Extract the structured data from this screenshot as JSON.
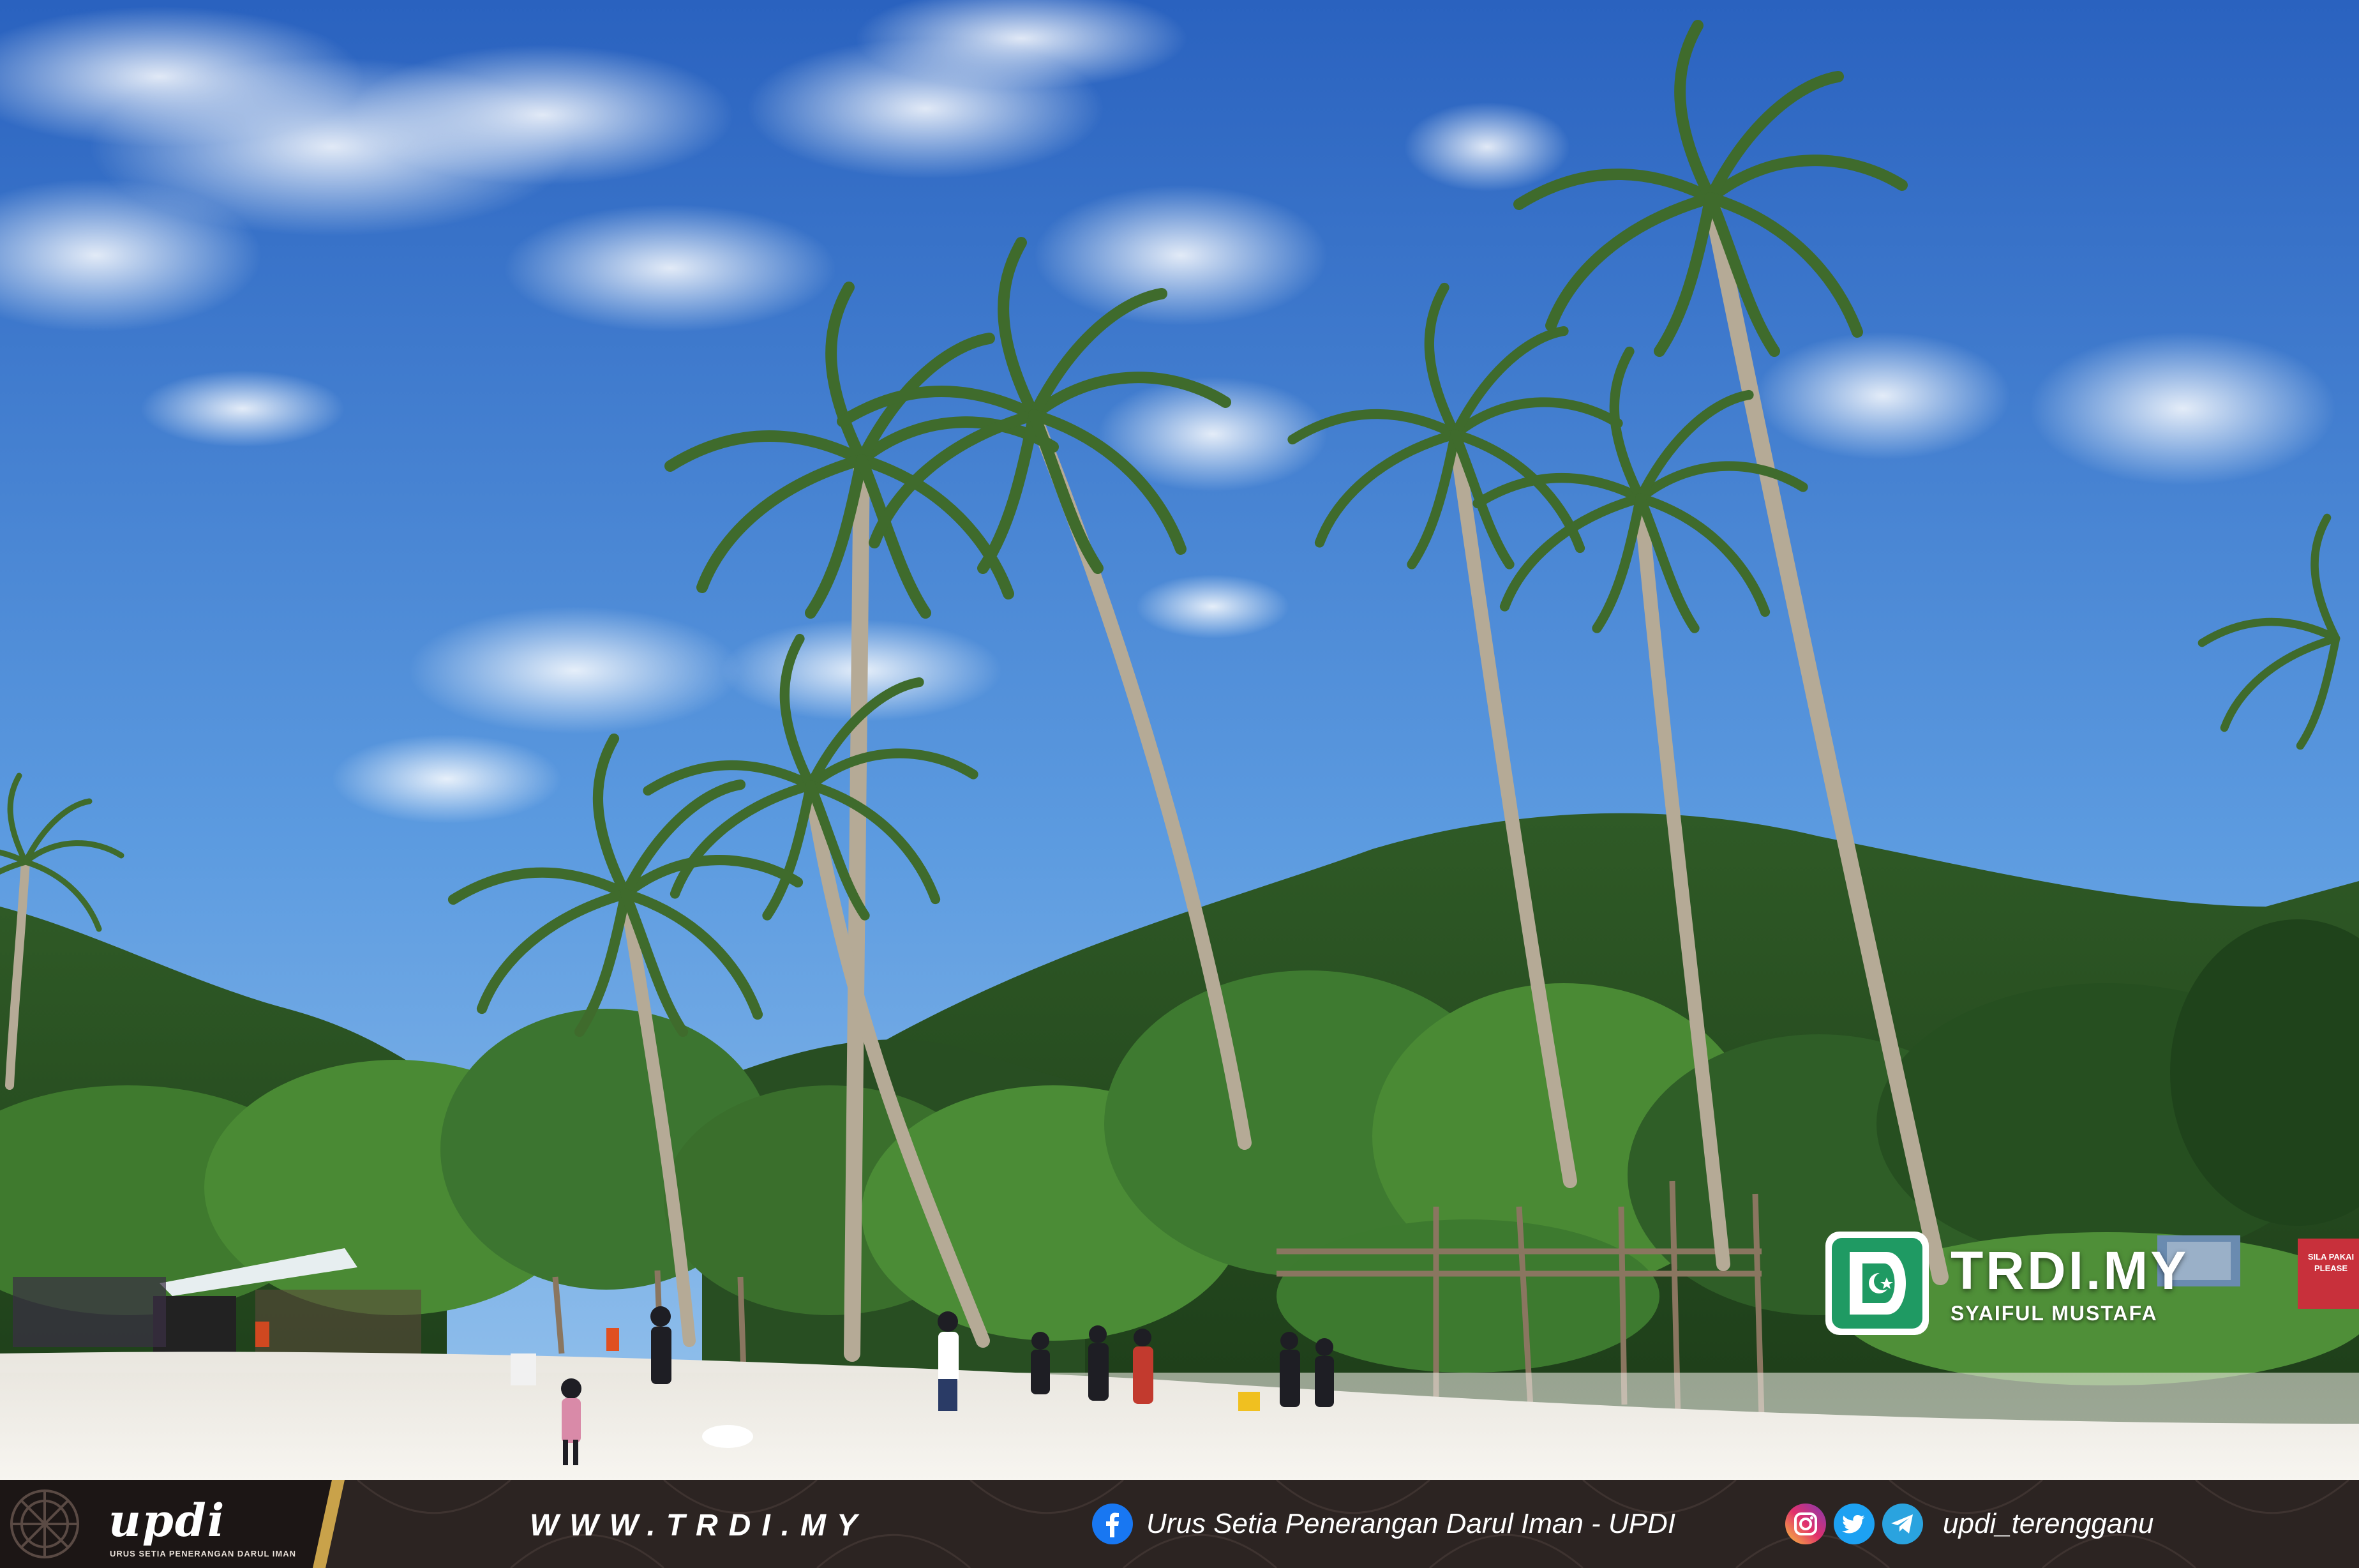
{
  "watermark": {
    "title": "TRDI.MY",
    "credit": "SYAIFUL MUSTAFA"
  },
  "sign_text": {
    "line1": "SILA PAKAI",
    "line2": "PLEASE"
  },
  "footer": {
    "badge_name": "updi",
    "badge_sub": "URUS SETIA PENERANGAN DARUL IMAN",
    "website": "WWW.TRDI.MY",
    "facebook_text": "Urus Setia Penerangan Darul Iman - UPDI",
    "social_handle": "updi_terengganu"
  },
  "colors": {
    "sky_top": "#2f6fc7",
    "sky_bottom": "#8fbde8",
    "sand": "#f2efe9",
    "forest": "#2f5a2a",
    "footer_bg": "#2c2422",
    "brand_green": "#1f9a63",
    "sign_red": "#c8303b",
    "facebook_blue": "#1877f2",
    "twitter_blue": "#1da1f2",
    "telegram_blue": "#2aa3df"
  },
  "icons": [
    "facebook-icon",
    "instagram-icon",
    "twitter-icon",
    "telegram-icon",
    "trdi-logo-icon",
    "updi-logo-icon"
  ]
}
